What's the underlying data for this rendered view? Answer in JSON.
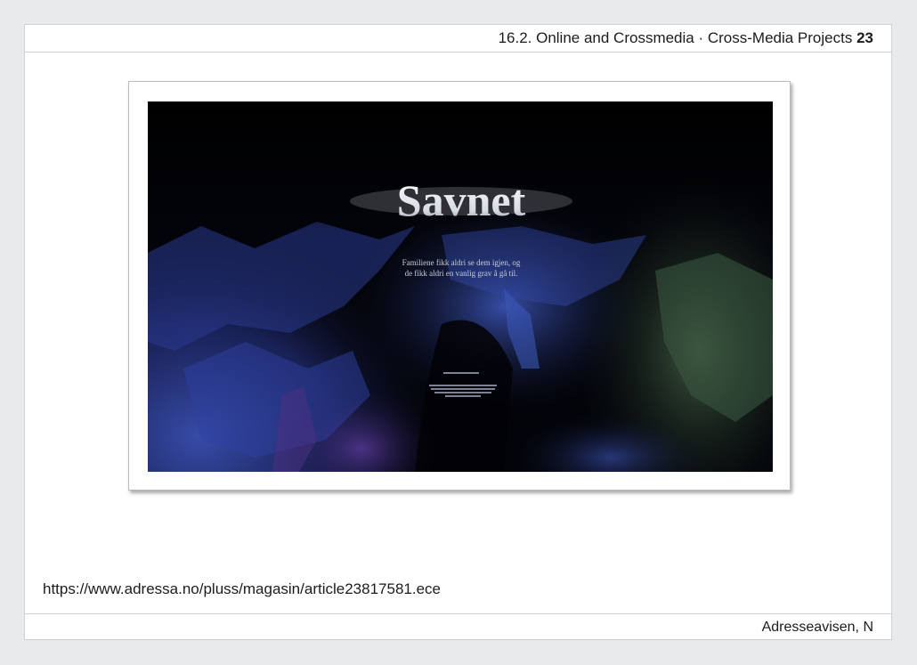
{
  "header": {
    "title": "16.2. Online and Crossmedia · Cross-Media Projects",
    "page_number": "23"
  },
  "screenshot": {
    "headline": "Savnet",
    "lede_line1": "Familiene fikk aldri se dem igjen, og",
    "lede_line2": "de fikk aldri en vanlig grav å gå til."
  },
  "url": "https://www.adressa.no/pluss/magasin/article23817581.ece",
  "footer": {
    "source": "Adresseavisen, N"
  },
  "colors": {
    "page_background": "#e9eaec",
    "screenshot_background": "#020308",
    "rock_blue": "#2a3a8a",
    "rock_green": "#2f4a3a"
  }
}
